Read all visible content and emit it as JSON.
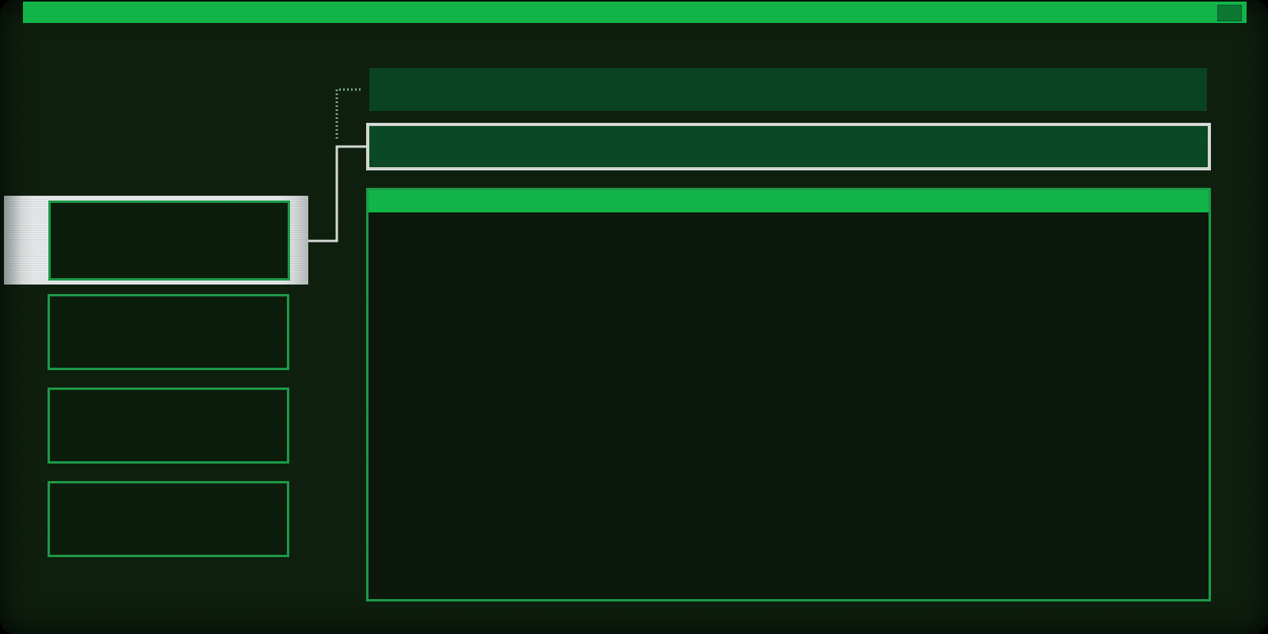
{
  "window": {
    "title": "",
    "control_label": ""
  },
  "menu": {
    "items": [
      {
        "label": "",
        "selected": true
      },
      {
        "label": "",
        "selected": false
      },
      {
        "label": "",
        "selected": false
      },
      {
        "label": "",
        "selected": false
      }
    ]
  },
  "header": {
    "text": ""
  },
  "input": {
    "value": "",
    "placeholder": ""
  },
  "panel": {
    "title": "",
    "body": ""
  },
  "colors": {
    "background": "#0f200f",
    "accent": "#12b84a",
    "border": "#1d9c48",
    "selection": "#e6e9e9",
    "header_fill": "#0a4422"
  }
}
